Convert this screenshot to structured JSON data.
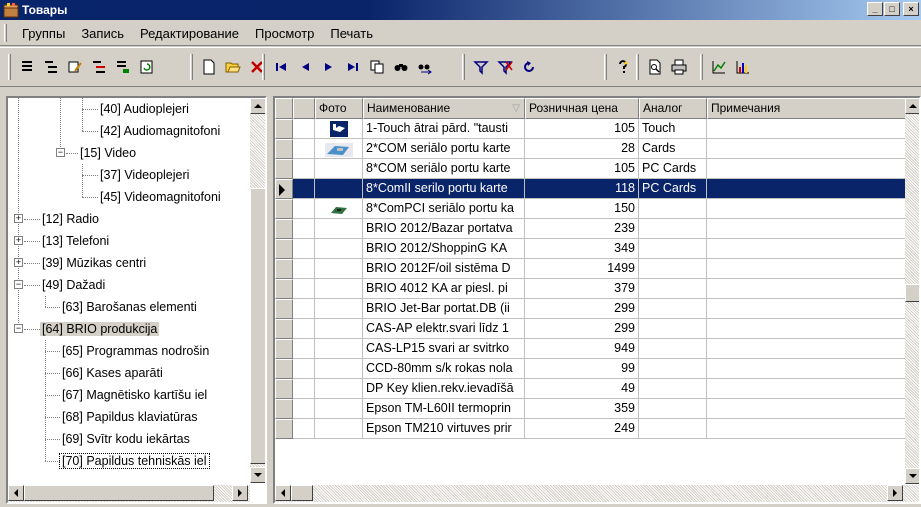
{
  "window": {
    "title": "Товары",
    "caption_buttons": {
      "minimize": "_",
      "maximize": "□",
      "close": "×"
    }
  },
  "menu": {
    "items": [
      "Группы",
      "Запись",
      "Редактирование",
      "Просмотр",
      "Печать"
    ]
  },
  "toolbar": {
    "groups": [
      [
        "list-icon",
        "tree-expand-icon",
        "group-edit-icon",
        "tree-collapse-icon",
        "subgroup-icon",
        "refresh-group-icon"
      ],
      [
        "new-record-icon",
        "open-folder-icon",
        "delete-icon"
      ],
      [
        "first-record-icon",
        "prev-record-icon",
        "next-record-icon",
        "last-record-icon",
        "copy-icon",
        "find-icon",
        "find-next-icon"
      ],
      [
        "filter-icon",
        "clear-filter-icon",
        "refresh-icon"
      ],
      [
        "help-icon"
      ],
      [
        "print-preview-icon",
        "print-icon"
      ],
      [
        "chart-line-icon",
        "chart-bar-icon"
      ]
    ]
  },
  "tree": {
    "items": [
      {
        "label": "[40] Audioplejeri",
        "level": 3,
        "expander": null
      },
      {
        "label": "[42] Audiomagnitofoni",
        "level": 3,
        "expander": null
      },
      {
        "label": "[15] Video",
        "level": 2,
        "expander": "-"
      },
      {
        "label": "[37] Videoplejeri",
        "level": 3,
        "expander": null
      },
      {
        "label": "[45] Videomagnitofoni",
        "level": 3,
        "expander": null
      },
      {
        "label": "[12] Radio",
        "level": 1,
        "expander": "+"
      },
      {
        "label": "[13] Telefoni",
        "level": 1,
        "expander": "+"
      },
      {
        "label": "[39] Mūzikas centri",
        "level": 1,
        "expander": "+"
      },
      {
        "label": "[49] Dažadi",
        "level": 1,
        "expander": "-"
      },
      {
        "label": "[63] Barošanas elementi",
        "level": 2,
        "expander": null
      },
      {
        "label": "[64] BRIO produkcija",
        "level": 1,
        "expander": "-",
        "selected": true
      },
      {
        "label": "[65] Programmas nodrošin",
        "level": 2,
        "expander": null
      },
      {
        "label": "[66] Kases aparāti",
        "level": 2,
        "expander": null
      },
      {
        "label": "[67] Magnētisko kartīšu iel",
        "level": 2,
        "expander": null
      },
      {
        "label": "[68] Papildus klaviatūras",
        "level": 2,
        "expander": null
      },
      {
        "label": "[69] Svītr kodu iekārtas",
        "level": 2,
        "expander": null
      },
      {
        "label": "[70] Papildus tehniskās iel",
        "level": 2,
        "expander": null,
        "focused": true
      }
    ]
  },
  "grid": {
    "columns": [
      {
        "key": "photo",
        "label": "Фото"
      },
      {
        "key": "name",
        "label": "Наименование",
        "sort": "▽"
      },
      {
        "key": "price",
        "label": "Розничная цена"
      },
      {
        "key": "analog",
        "label": "Аналог"
      },
      {
        "key": "notes",
        "label": "Примечания"
      }
    ],
    "rows": [
      {
        "photo": "hand-icon",
        "name": "1-Touch ātrai pārd. \"tausti",
        "price": "105",
        "analog": "Touch",
        "notes": ""
      },
      {
        "photo": "card-photo",
        "name": "2*COM seriālo portu karte",
        "price": "28",
        "analog": "Cards",
        "notes": ""
      },
      {
        "photo": "",
        "name": "8*COM seriālo portu karte",
        "price": "105",
        "analog": "PC Cards",
        "notes": ""
      },
      {
        "photo": "",
        "name": "8*ComII serilo portu karte",
        "price": "118",
        "analog": "PC Cards",
        "notes": "",
        "selected": true
      },
      {
        "photo": "pcb-photo",
        "name": "8*ComPCI seriālo portu ka",
        "price": "150",
        "analog": "",
        "notes": ""
      },
      {
        "photo": "",
        "name": "BRIO 2012/Bazar portatva",
        "price": "239",
        "analog": "",
        "notes": ""
      },
      {
        "photo": "",
        "name": "BRIO 2012/ShoppinG KA",
        "price": "349",
        "analog": "",
        "notes": ""
      },
      {
        "photo": "",
        "name": "BRIO 2012F/oil sistēma D",
        "price": "1499",
        "analog": "",
        "notes": ""
      },
      {
        "photo": "",
        "name": "BRIO 4012 KA ar piesl. pi",
        "price": "379",
        "analog": "",
        "notes": ""
      },
      {
        "photo": "",
        "name": "BRIO Jet-Bar portat.DB (ii",
        "price": "299",
        "analog": "",
        "notes": ""
      },
      {
        "photo": "",
        "name": "CAS-AP elektr.svari līdz 1",
        "price": "299",
        "analog": "",
        "notes": ""
      },
      {
        "photo": "",
        "name": "CAS-LP15 svari ar svitrko",
        "price": "949",
        "analog": "",
        "notes": ""
      },
      {
        "photo": "",
        "name": "CCD-80mm s/k rokas nola",
        "price": "99",
        "analog": "",
        "notes": ""
      },
      {
        "photo": "",
        "name": "DP Key klien.rekv.ievadīšā",
        "price": "49",
        "analog": "",
        "notes": ""
      },
      {
        "photo": "",
        "name": "Epson TM-L60II termoprin",
        "price": "359",
        "analog": "",
        "notes": ""
      },
      {
        "photo": "",
        "name": "Epson TM210 virtuves prir",
        "price": "249",
        "analog": "",
        "notes": ""
      }
    ]
  },
  "colors": {
    "selection": "#0a246a",
    "face": "#d4d0c8",
    "title_gradient_end": "#a6caf0"
  }
}
